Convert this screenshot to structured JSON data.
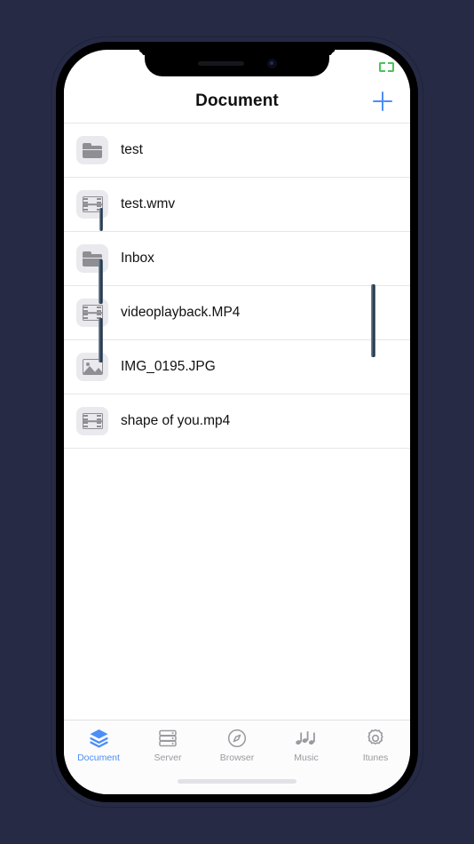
{
  "device": {
    "status_bar": {
      "battery_icon": "battery-icon",
      "battery_color": "#49c35a"
    },
    "notch": {
      "speaker_icon": "speaker-grille-icon",
      "camera_icon": "front-camera-icon"
    },
    "home_indicator": "home-indicator",
    "buttons": {
      "silent_switch": "silent-switch",
      "volume_up": "volume-up-button",
      "volume_down": "volume-down-button",
      "power": "power-button"
    }
  },
  "nav": {
    "title": "Document",
    "add_label": "+",
    "add_icon": "plus-icon",
    "accent_color": "#4c8ef7"
  },
  "files": [
    {
      "name": "test",
      "icon": "folder-icon",
      "type": "folder"
    },
    {
      "name": "test.wmv",
      "icon": "film-icon",
      "type": "video"
    },
    {
      "name": "Inbox",
      "icon": "folder-icon",
      "type": "folder"
    },
    {
      "name": "videoplayback.MP4",
      "icon": "film-icon",
      "type": "video"
    },
    {
      "name": "IMG_0195.JPG",
      "icon": "photo-icon",
      "type": "image"
    },
    {
      "name": "shape of you.mp4",
      "icon": "film-icon",
      "type": "video"
    }
  ],
  "tabs": [
    {
      "label": "Document",
      "icon": "layers-icon",
      "active": true
    },
    {
      "label": "Server",
      "icon": "server-icon",
      "active": false
    },
    {
      "label": "Browser",
      "icon": "compass-icon",
      "active": false
    },
    {
      "label": "Music",
      "icon": "music-note-icon",
      "active": false
    },
    {
      "label": "Itunes",
      "icon": "gear-icon",
      "active": false
    }
  ],
  "colors": {
    "background": "#272a45",
    "accent": "#4c8ef7",
    "inactive_tab": "#9a9a9f",
    "icon_gray": "#8e8e93",
    "icon_bg": "#e9e9ee",
    "separator": "#e6e6e8"
  }
}
